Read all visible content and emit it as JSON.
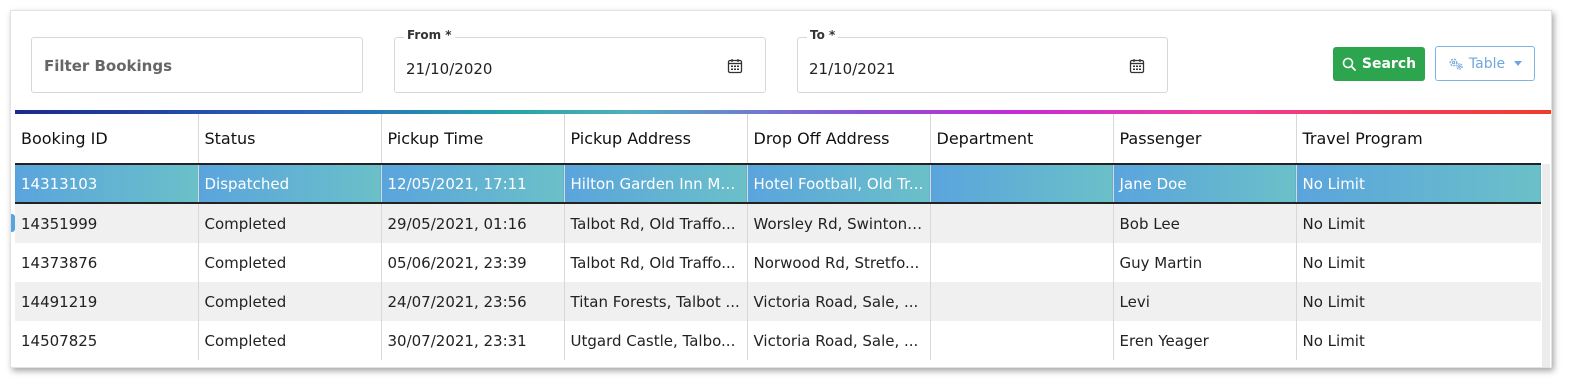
{
  "filters": {
    "filter_placeholder": "Filter Bookings",
    "from_label": "From *",
    "from_value": "21/10/2020",
    "to_label": "To *",
    "to_value": "21/10/2021"
  },
  "actions": {
    "search_label": "Search",
    "view_label": "Table"
  },
  "table": {
    "columns": [
      "Booking ID",
      "Status",
      "Pickup Time",
      "Pickup Address",
      "Drop Off Address",
      "Department",
      "Passenger",
      "Travel Program"
    ],
    "rows": [
      [
        "14313103",
        "Dispatched",
        "12/05/2021, 17:11",
        "Hilton Garden Inn Ma...",
        "Hotel Football, Old Tr...",
        "",
        "Jane Doe",
        "No Limit"
      ],
      [
        "14351999",
        "Completed",
        "29/05/2021, 01:16",
        "Talbot Rd, Old Traffo...",
        "Worsley Rd, Swinton, ...",
        "",
        "Bob Lee",
        "No Limit"
      ],
      [
        "14373876",
        "Completed",
        "05/06/2021, 23:39",
        "Talbot Rd, Old Traffo...",
        "Norwood Rd, Stretfo...",
        "",
        "Guy Martin",
        "No Limit"
      ],
      [
        "14491219",
        "Completed",
        "24/07/2021, 23:56",
        "Titan Forests, Talbot ...",
        "Victoria Road, Sale, ...",
        "",
        "Levi",
        "No Limit"
      ],
      [
        "14507825",
        "Completed",
        "30/07/2021, 23:31",
        "Utgard Castle, Talbo...",
        "Victoria Road, Sale, ...",
        "",
        "Eren Yeager",
        "No Limit"
      ]
    ],
    "selected_row": 0
  },
  "colors": {
    "search_button": "#2da44e",
    "accent_blue": "#6fa8dc",
    "selected_row_start": "#5aa4dd",
    "selected_row_end": "#6bc0c8"
  },
  "icons": {
    "search": "search-icon",
    "calendar": "calendar-icon",
    "view": "settings-gears-icon",
    "dropdown": "chevron-down-icon"
  }
}
